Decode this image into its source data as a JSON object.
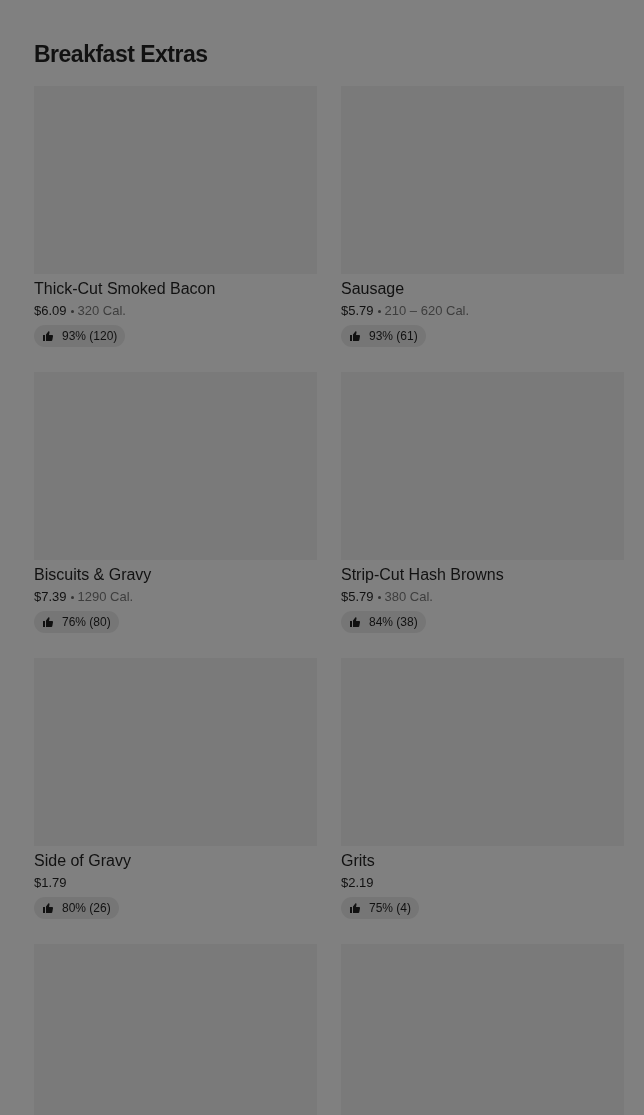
{
  "section": {
    "title": "Breakfast Extras"
  },
  "items": [
    {
      "kind": "full",
      "name": "Thick-Cut Smoked Bacon",
      "price": "$6.09",
      "calories": "320 Cal.",
      "rating": "93% (120)"
    },
    {
      "kind": "full",
      "name": "Sausage",
      "price": "$5.79",
      "calories": "210 – 620 Cal.",
      "rating": "93% (61)"
    },
    {
      "kind": "full",
      "name": "Biscuits & Gravy",
      "price": "$7.39",
      "calories": "1290 Cal.",
      "rating": "76% (80)"
    },
    {
      "kind": "full",
      "name": "Strip-Cut Hash Browns",
      "price": "$5.79",
      "calories": "380 Cal.",
      "rating": "84% (38)"
    },
    {
      "kind": "full",
      "name": "Side of Gravy",
      "price": "$1.79",
      "rating": "80% (26)"
    },
    {
      "kind": "full",
      "name": "Grits",
      "price": "$2.19",
      "rating": "75% (4)"
    },
    {
      "kind": "image_only"
    },
    {
      "kind": "image_only"
    }
  ]
}
